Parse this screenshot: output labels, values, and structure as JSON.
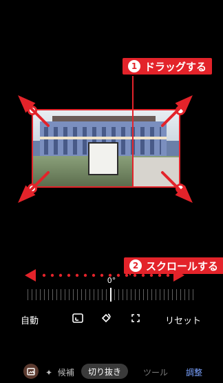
{
  "callouts": {
    "drag": {
      "number": "1",
      "text": "ドラッグする"
    },
    "scroll": {
      "number": "2",
      "text": "スクロールする"
    }
  },
  "rotation": {
    "degree_label": "0°",
    "value_degrees": 0
  },
  "controls": {
    "auto_label": "自動",
    "reset_label": "リセット"
  },
  "bottom_tabs": {
    "suggest_label": "候補",
    "crop_label": "切り抜き",
    "tools_label": "ツール",
    "adjust_label": "調整"
  },
  "icons": {
    "suggest": "sparkle-icon",
    "aspect": "aspect-ratio-icon",
    "rotate": "rotate-icon",
    "free": "free-crop-icon",
    "app": "photo-edit-icon"
  },
  "colors": {
    "accent_red": "#e3232a",
    "active_tab": "#7aa2ff"
  }
}
